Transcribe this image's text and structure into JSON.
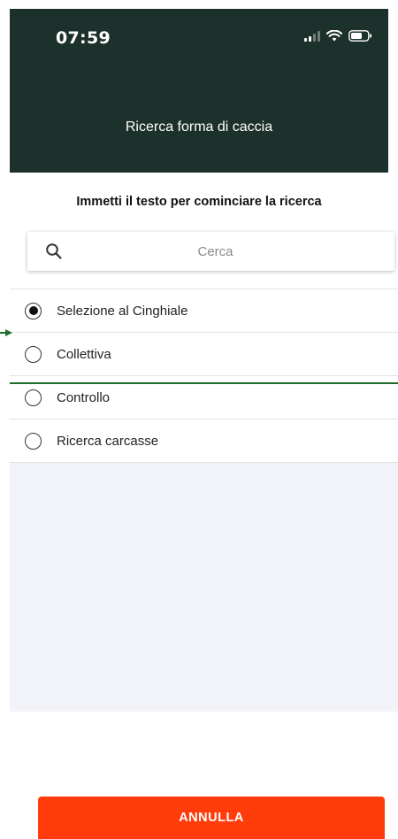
{
  "status_bar": {
    "time": "07:59",
    "icons": [
      "signal-icon",
      "wifi-icon",
      "battery-icon"
    ]
  },
  "header": {
    "title": "Ricerca forma di caccia",
    "background": "#1d312c"
  },
  "prompt": "Immetti il testo per cominciare la ricerca",
  "search": {
    "value": "",
    "placeholder": "Cerca",
    "icon": "search-icon"
  },
  "options": [
    {
      "label": "Selezione al Cinghiale",
      "selected": true
    },
    {
      "label": "Collettiva",
      "selected": false
    },
    {
      "label": "Controllo",
      "selected": false
    },
    {
      "label": "Ricerca carcasse",
      "selected": false
    }
  ],
  "footer": {
    "cancel_label": "ANNULLA",
    "accent": "#ff3c0a"
  },
  "annotation_color": "#1f6b2a"
}
